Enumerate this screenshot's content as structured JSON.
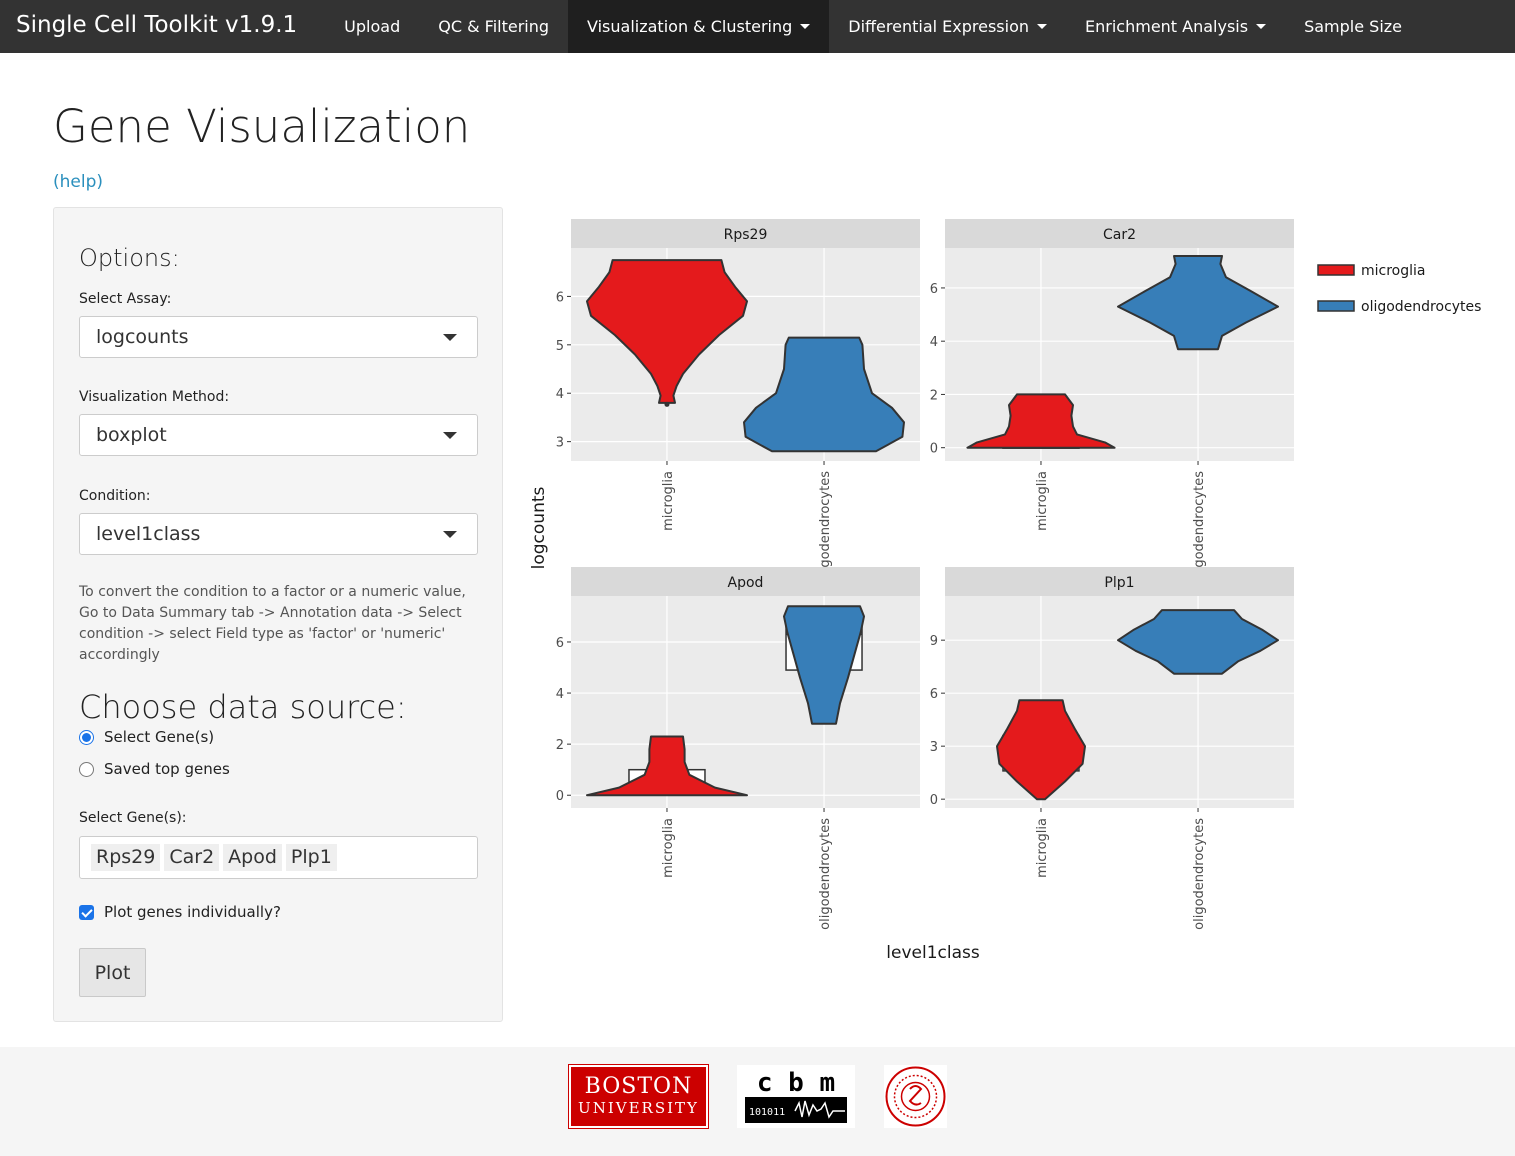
{
  "navbar": {
    "brand": "Single Cell Toolkit v1.9.1",
    "items": [
      {
        "label": "Upload",
        "dropdown": false,
        "active": false
      },
      {
        "label": "QC & Filtering",
        "dropdown": false,
        "active": false
      },
      {
        "label": "Visualization & Clustering",
        "dropdown": true,
        "active": true
      },
      {
        "label": "Differential Expression",
        "dropdown": true,
        "active": false
      },
      {
        "label": "Enrichment Analysis",
        "dropdown": true,
        "active": false
      },
      {
        "label": "Sample Size",
        "dropdown": false,
        "active": false
      }
    ]
  },
  "page": {
    "title": "Gene Visualization",
    "help_link": "(help)"
  },
  "sidebar": {
    "options_heading": "Options:",
    "assay_label": "Select Assay:",
    "assay_value": "logcounts",
    "method_label": "Visualization Method:",
    "method_value": "boxplot",
    "condition_label": "Condition:",
    "condition_value": "level1class",
    "help_text": "To convert the condition to a factor or a numeric value, Go to Data Summary tab -> Annotation data -> Select condition -> select Field type as 'factor' or 'numeric' accordingly",
    "source_heading": "Choose data source:",
    "radio_options": [
      "Select Gene(s)",
      "Saved top genes"
    ],
    "radio_selected": "Select Gene(s)",
    "genes_label": "Select Gene(s):",
    "genes": [
      "Rps29",
      "Car2",
      "Apod",
      "Plp1"
    ],
    "checkbox_label": "Plot genes individually?",
    "checkbox_checked": true,
    "plot_button": "Plot"
  },
  "footer": {
    "bu_logo_line1": "BOSTON",
    "bu_logo_line2": "UNIVERSITY",
    "cbm_logo_text": "c b m",
    "cbm_binary": "101011",
    "logos": [
      "boston-university-logo",
      "cbm-logo",
      "bu-seal-logo"
    ]
  },
  "colors": {
    "microglia": "#e41a1c",
    "oligodendrocytes": "#377eb8",
    "panel_bg": "#ebebeb",
    "strip_bg": "#d9d9d9",
    "navbar": "#333333"
  },
  "chart_data": {
    "type": "violin",
    "xlabel": "level1class",
    "ylabel": "logcounts",
    "categories": [
      "microglia",
      "oligodendrocytes"
    ],
    "legend": {
      "position": "right",
      "entries": [
        {
          "label": "microglia",
          "color": "#e41a1c"
        },
        {
          "label": "oligodendrocytes",
          "color": "#377eb8"
        }
      ]
    },
    "panels": [
      {
        "gene": "Rps29",
        "ylim": [
          2.6,
          7.0
        ],
        "yticks": [
          3,
          4,
          5,
          6
        ],
        "violins": [
          {
            "group": "microglia",
            "min": 3.8,
            "max": 6.75,
            "outlier": 3.77,
            "box": [
              5.2,
              5.8,
              6.3
            ],
            "profile": [
              [
                3.8,
                0.1
              ],
              [
                3.95,
                0.08
              ],
              [
                4.15,
                0.12
              ],
              [
                4.4,
                0.2
              ],
              [
                4.8,
                0.4
              ],
              [
                5.2,
                0.65
              ],
              [
                5.6,
                0.95
              ],
              [
                5.9,
                1.0
              ],
              [
                6.2,
                0.85
              ],
              [
                6.5,
                0.72
              ],
              [
                6.75,
                0.68
              ]
            ]
          },
          {
            "group": "oligodendrocytes",
            "min": 2.8,
            "max": 5.15,
            "box": [
              3.2,
              3.6,
              4.6
            ],
            "profile": [
              [
                2.8,
                0.65
              ],
              [
                3.1,
                0.98
              ],
              [
                3.4,
                1.0
              ],
              [
                3.7,
                0.85
              ],
              [
                4.0,
                0.6
              ],
              [
                4.5,
                0.5
              ],
              [
                5.0,
                0.48
              ],
              [
                5.15,
                0.44
              ]
            ]
          }
        ]
      },
      {
        "gene": "Car2",
        "ylim": [
          -0.5,
          7.5
        ],
        "yticks": [
          0,
          2,
          4,
          6
        ],
        "violins": [
          {
            "group": "microglia",
            "min": 0.0,
            "max": 2.0,
            "box": [
              0.0,
              0.0,
              0.0
            ],
            "profile": [
              [
                0.0,
                0.92
              ],
              [
                0.2,
                0.8
              ],
              [
                0.5,
                0.45
              ],
              [
                0.8,
                0.4
              ],
              [
                1.2,
                0.38
              ],
              [
                1.6,
                0.4
              ],
              [
                2.0,
                0.3
              ]
            ]
          },
          {
            "group": "oligodendrocytes",
            "min": 3.7,
            "max": 7.2,
            "box": [
              4.8,
              5.5,
              6.1
            ],
            "profile": [
              [
                3.7,
                0.25
              ],
              [
                4.2,
                0.3
              ],
              [
                4.7,
                0.6
              ],
              [
                5.3,
                1.0
              ],
              [
                5.9,
                0.65
              ],
              [
                6.4,
                0.35
              ],
              [
                6.9,
                0.28
              ],
              [
                7.2,
                0.3
              ]
            ]
          }
        ]
      },
      {
        "gene": "Apod",
        "ylim": [
          -0.5,
          7.8
        ],
        "yticks": [
          0,
          2,
          4,
          6
        ],
        "violins": [
          {
            "group": "microglia",
            "min": 0.0,
            "max": 2.3,
            "box": [
              0.0,
              0.0,
              1.0
            ],
            "profile": [
              [
                0.0,
                1.0
              ],
              [
                0.3,
                0.6
              ],
              [
                0.8,
                0.28
              ],
              [
                1.3,
                0.22
              ],
              [
                1.8,
                0.22
              ],
              [
                2.3,
                0.2
              ]
            ]
          },
          {
            "group": "oligodendrocytes",
            "min": 2.8,
            "max": 7.4,
            "box": [
              4.9,
              6.3,
              6.95
            ],
            "profile": [
              [
                2.8,
                0.15
              ],
              [
                3.6,
                0.2
              ],
              [
                4.6,
                0.3
              ],
              [
                5.5,
                0.38
              ],
              [
                6.4,
                0.46
              ],
              [
                7.0,
                0.5
              ],
              [
                7.4,
                0.45
              ]
            ]
          }
        ]
      },
      {
        "gene": "Plp1",
        "ylim": [
          -0.5,
          11.5
        ],
        "yticks": [
          0,
          3,
          6,
          9
        ],
        "violins": [
          {
            "group": "microglia",
            "min": 0.0,
            "max": 5.6,
            "box": [
              1.6,
              2.8,
              3.6
            ],
            "profile": [
              [
                0.0,
                0.05
              ],
              [
                1.0,
                0.3
              ],
              [
                2.0,
                0.52
              ],
              [
                3.0,
                0.55
              ],
              [
                4.0,
                0.42
              ],
              [
                5.0,
                0.3
              ],
              [
                5.6,
                0.27
              ]
            ]
          },
          {
            "group": "oligodendrocytes",
            "min": 7.1,
            "max": 10.7,
            "box": [
              8.5,
              9.2,
              9.8
            ],
            "profile": [
              [
                7.1,
                0.3
              ],
              [
                7.8,
                0.5
              ],
              [
                8.4,
                0.78
              ],
              [
                9.0,
                1.0
              ],
              [
                9.6,
                0.8
              ],
              [
                10.2,
                0.55
              ],
              [
                10.7,
                0.45
              ]
            ]
          }
        ]
      }
    ]
  }
}
